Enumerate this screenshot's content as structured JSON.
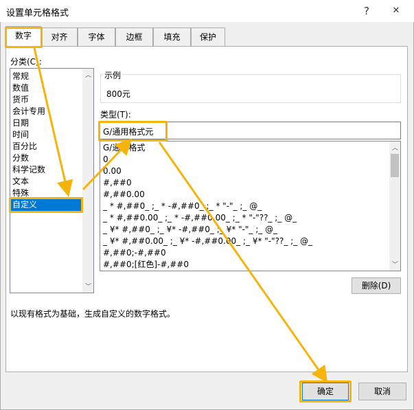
{
  "window": {
    "title": "设置单元格格式",
    "help_glyph": "?",
    "close_glyph": "✕"
  },
  "tabs": [
    {
      "label": "数字"
    },
    {
      "label": "对齐"
    },
    {
      "label": "字体"
    },
    {
      "label": "边框"
    },
    {
      "label": "填充"
    },
    {
      "label": "保护"
    }
  ],
  "category": {
    "label": "分类(C):",
    "items": [
      "常规",
      "数值",
      "货币",
      "会计专用",
      "日期",
      "时间",
      "百分比",
      "分数",
      "科学记数",
      "文本",
      "特殊",
      "自定义"
    ],
    "selected": "自定义"
  },
  "sample": {
    "label": "示例",
    "value": "800元"
  },
  "type": {
    "label": "类型(T):",
    "input_value": "G/通用格式元",
    "formats": [
      "G/通用格式",
      "0",
      "0.00",
      "#,##0",
      "#,##0.00",
      "_ * #,##0_ ;_ * -#,##0_ ;_ * \"-\"_ ;_ @_",
      "_ * #,##0.00_ ;_ * -#,##0.00_ ;_ * \"-\"??_ ;_ @_",
      "_ ¥* #,##0_ ;_ ¥* -#,##0_ ;_ ¥* \"-\"_ ;_ @_",
      "_ ¥* #,##0.00_ ;_ ¥* -#,##0.00_ ;_ ¥* \"-\"??_ ;_ @_",
      "#,##0;-#,##0",
      "#,##0;[红色]-#,##0"
    ]
  },
  "buttons": {
    "delete": "删除(D)",
    "ok": "确定",
    "cancel": "取消"
  },
  "description": "以现有格式为基础，生成自定义的数字格式。",
  "colors": {
    "highlight": "#f6b40a",
    "selection": "#0078d7"
  }
}
